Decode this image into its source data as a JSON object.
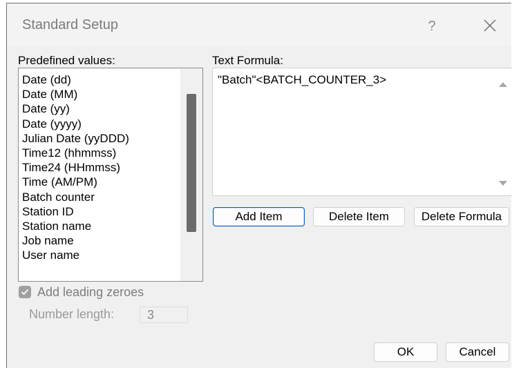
{
  "window": {
    "title": "Standard Setup",
    "help_glyph": "?",
    "close_glyph": "✕"
  },
  "predefined": {
    "label": "Predefined values:",
    "items": [
      "Date (dd)",
      "Date (MM)",
      "Date (yy)",
      "Date (yyyy)",
      "Julian Date (yyDDD)",
      "Time12 (hhmmss)",
      "Time24 (HHmmss)",
      "Time (AM/PM)",
      "Batch counter",
      "Station ID",
      "Station name",
      "Job name",
      "User name"
    ]
  },
  "formula": {
    "label": "Text Formula:",
    "value": "\"Batch\"<BATCH_COUNTER_3>"
  },
  "buttons": {
    "add_item": "Add Item",
    "delete_item": "Delete Item",
    "delete_formula": "Delete Formula",
    "ok": "OK",
    "cancel": "Cancel"
  },
  "options": {
    "leading_zeroes_label": "Add leading zeroes",
    "leading_zeroes_checked": true,
    "number_length_label": "Number length:",
    "number_length_value": "3"
  },
  "colors": {
    "dialog_bg": "#f0f0f0",
    "default_button_border": "#005fb8",
    "disabled_text": "#9a9a9a"
  }
}
